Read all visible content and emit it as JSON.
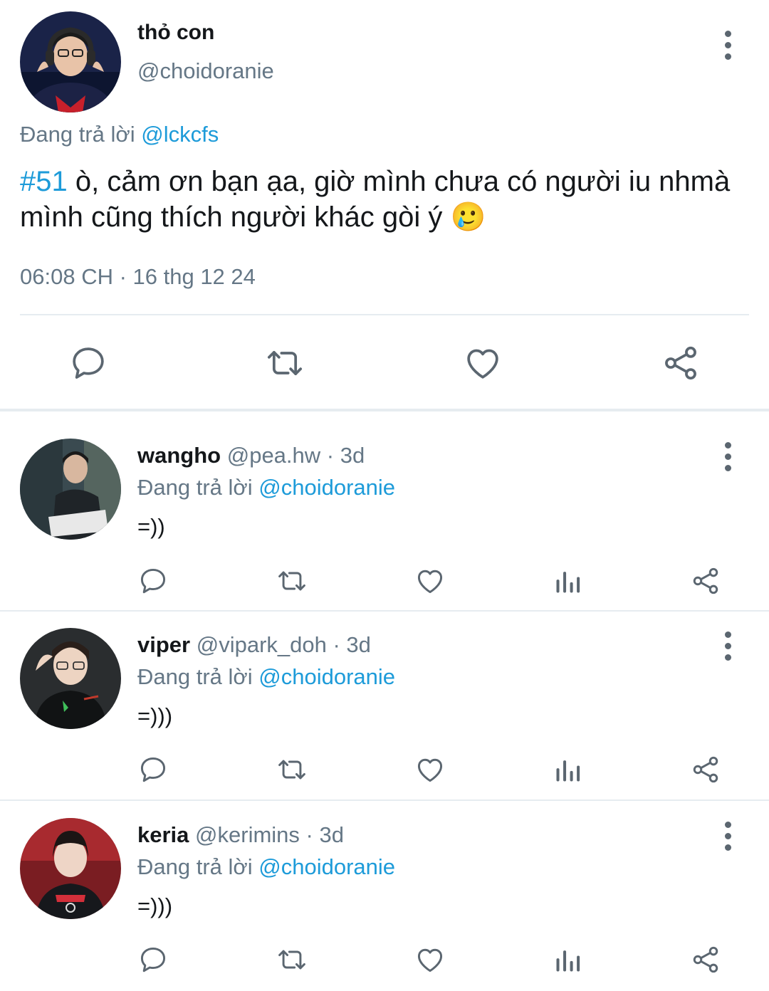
{
  "main_tweet": {
    "display_name": "thỏ con",
    "handle": "@choidoranie",
    "replying_prefix": "Đang trả lời",
    "replying_to": "@lckcfs",
    "hashtag": "#51",
    "text_after_hashtag": " ò, cảm ơn bạn ạa, giờ mình chưa có người iu nhmà",
    "text_line2": "mình cũng thích người khác gòi ý",
    "emoji": "🥲",
    "timestamp": "06:08 CH · 16 thg 12 24",
    "actions": [
      "reply-icon",
      "retweet-icon",
      "like-icon",
      "share-icon"
    ]
  },
  "replies": [
    {
      "display_name": "wangho",
      "handle": "@pea.hw",
      "age": "· 3d",
      "replying_prefix": "Đang trả lời",
      "replying_to": "@choidoranie",
      "text": "=))"
    },
    {
      "display_name": "viper",
      "handle": "@vipark_doh",
      "age": "· 3d",
      "replying_prefix": "Đang trả lời",
      "replying_to": "@choidoranie",
      "text": "=)))"
    },
    {
      "display_name": "keria",
      "handle": "@kerimins",
      "age": "· 3d",
      "replying_prefix": "Đang trả lời",
      "replying_to": "@choidoranie",
      "text": "=)))"
    }
  ],
  "reply_actions": [
    "reply-icon",
    "retweet-icon",
    "like-icon",
    "stats-icon",
    "share-icon"
  ],
  "colors": {
    "link": "#1d9bd9",
    "secondary_text": "#657786",
    "icon": "#5b6670",
    "divider": "#e6ecf0"
  }
}
